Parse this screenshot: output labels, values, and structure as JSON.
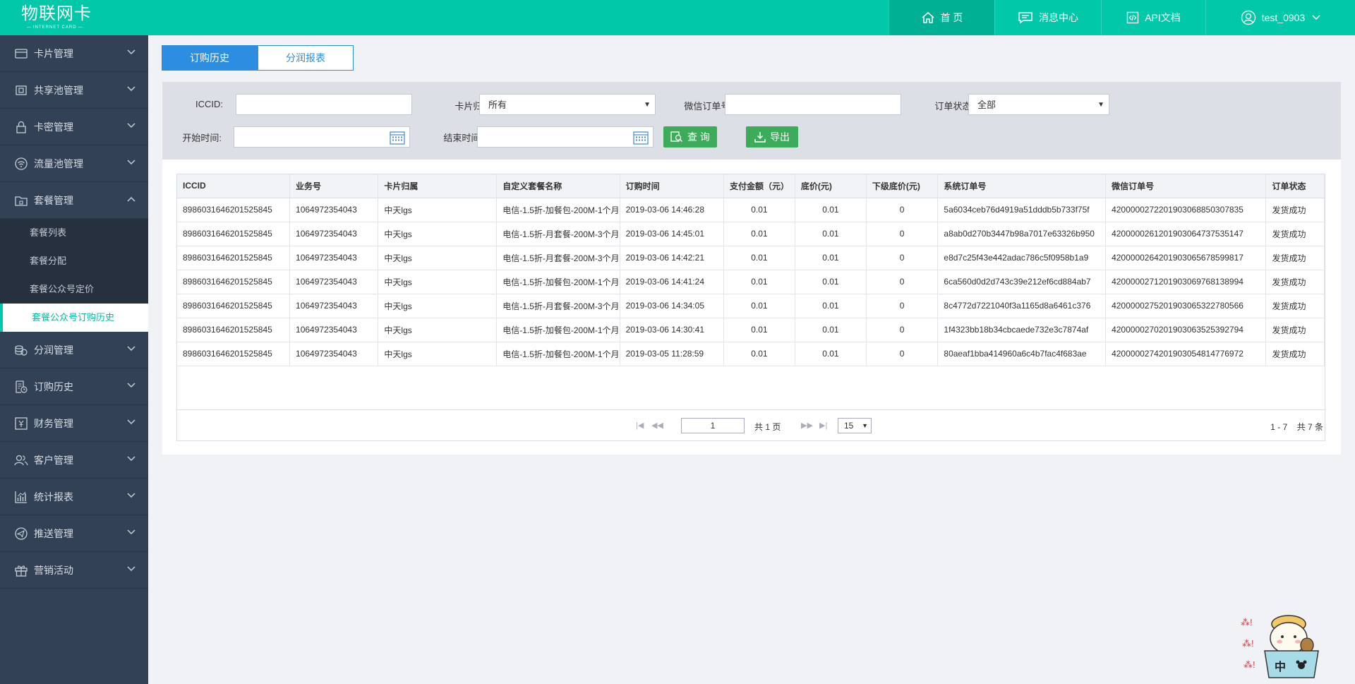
{
  "header": {
    "logo": "物联网卡",
    "logo_sub": "INTERNET CARD",
    "nav": {
      "home": "首 页",
      "messages": "消息中心",
      "api": "API文档",
      "user": "test_0903"
    }
  },
  "sidebar": {
    "groups": [
      {
        "label": "卡片管理",
        "icon": "card-icon"
      },
      {
        "label": "共享池管理",
        "icon": "pool-icon"
      },
      {
        "label": "卡密管理",
        "icon": "lock-icon"
      },
      {
        "label": "流量池管理",
        "icon": "wifi-icon"
      },
      {
        "label": "套餐管理",
        "icon": "package-icon"
      },
      {
        "label": "分润管理",
        "icon": "coins-icon"
      },
      {
        "label": "订购历史",
        "icon": "history-icon"
      },
      {
        "label": "财务管理",
        "icon": "finance-icon"
      },
      {
        "label": "客户管理",
        "icon": "customers-icon"
      },
      {
        "label": "统计报表",
        "icon": "chart-icon"
      },
      {
        "label": "推送管理",
        "icon": "push-icon"
      },
      {
        "label": "营销活动",
        "icon": "gift-icon"
      }
    ],
    "package_subitems": [
      "套餐列表",
      "套餐分配",
      "套餐公众号定价",
      "套餐公众号订购历史"
    ]
  },
  "tabs": {
    "history": "订购历史",
    "report": "分润报表"
  },
  "filters": {
    "iccid_label": "ICCID:",
    "card_owner_label": "卡片归属:",
    "card_owner_value": "所有",
    "wechat_order_label": "微信订单号:",
    "order_status_label": "订单状态:",
    "order_status_value": "全部",
    "start_label": "开始时间:",
    "end_label": "结束时间:",
    "query_button": "查 询",
    "export_button": "导出"
  },
  "table": {
    "columns": [
      "ICCID",
      "业务号",
      "卡片归属",
      "自定义套餐名称",
      "订购时间",
      "支付金额（元）",
      "底价(元)",
      "下级底价(元)",
      "系统订单号",
      "微信订单号",
      "订单状态"
    ],
    "rows": [
      [
        "8986031646201525845",
        "1064972354043",
        "中天lgs",
        "电信-1.5折-加餐包-200M-1个月",
        "2019-03-06 14:46:28",
        "0.01",
        "0.01",
        "0",
        "5a6034ceb76d4919a51dddb5b733f75f",
        "4200000272201903068850307835",
        "发货成功"
      ],
      [
        "8986031646201525845",
        "1064972354043",
        "中天lgs",
        "电信-1.5折-月套餐-200M-3个月",
        "2019-03-06 14:45:01",
        "0.01",
        "0.01",
        "0",
        "a8ab0d270b3447b98a7017e63326b950",
        "4200000261201903064737535147",
        "发货成功"
      ],
      [
        "8986031646201525845",
        "1064972354043",
        "中天lgs",
        "电信-1.5折-月套餐-200M-3个月",
        "2019-03-06 14:42:21",
        "0.01",
        "0.01",
        "0",
        "e8d7c25f43e442adac786c5f0958b1a9",
        "4200000264201903065678599817",
        "发货成功"
      ],
      [
        "8986031646201525845",
        "1064972354043",
        "中天lgs",
        "电信-1.5折-加餐包-200M-1个月",
        "2019-03-06 14:41:24",
        "0.01",
        "0.01",
        "0",
        "6ca560d0d2d743c39e212ef6cd884ab7",
        "4200000271201903069768138994",
        "发货成功"
      ],
      [
        "8986031646201525845",
        "1064972354043",
        "中天lgs",
        "电信-1.5折-月套餐-200M-3个月",
        "2019-03-06 14:34:05",
        "0.01",
        "0.01",
        "0",
        "8c4772d7221040f3a1165d8a6461c376",
        "4200000275201903065322780566",
        "发货成功"
      ],
      [
        "8986031646201525845",
        "1064972354043",
        "中天lgs",
        "电信-1.5折-加餐包-200M-1个月",
        "2019-03-06 14:30:41",
        "0.01",
        "0.01",
        "0",
        "1f4323bb18b34cbcaede732e3c7874af",
        "4200000270201903063525392794",
        "发货成功"
      ],
      [
        "8986031646201525845",
        "1064972354043",
        "中天lgs",
        "电信-1.5折-加餐包-200M-1个月",
        "2019-03-05 11:28:59",
        "0.01",
        "0.01",
        "0",
        "80aeaf1bba414960a6c4b7fac4f683ae",
        "4200000274201903054814776972",
        "发货成功"
      ]
    ]
  },
  "pager": {
    "page": "1",
    "total_pages": "共 1 页",
    "page_size": "15",
    "info": "1 - 7    共 7 条"
  },
  "mascot": {
    "text": "中"
  },
  "colors": {
    "header": "#00c8a8",
    "sidebar": "#324155",
    "tab_active": "#2d8de0",
    "button_green": "#3cab5a"
  }
}
